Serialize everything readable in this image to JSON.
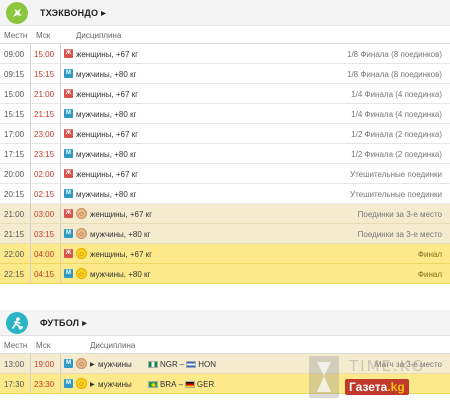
{
  "taekwondo": {
    "title": "ТХЭКВОНДО",
    "columns": {
      "local": "Местн",
      "msk": "Мск",
      "discipline": "Дисциплина"
    },
    "rows": [
      {
        "local": "09:00",
        "msk": "15:00",
        "gender": "Ж",
        "discipline": "женщины, +67 кг",
        "stage": "1/8 Финала (8 поединков)",
        "kind": "plain",
        "medal": ""
      },
      {
        "local": "09:15",
        "msk": "15:15",
        "gender": "М",
        "discipline": "мужчины, +80 кг",
        "stage": "1/8 Финала (8 поединков)",
        "kind": "plain",
        "medal": ""
      },
      {
        "local": "15:00",
        "msk": "21:00",
        "gender": "Ж",
        "discipline": "женщины, +67 кг",
        "stage": "1/4 Финала (4 поединка)",
        "kind": "plain",
        "medal": ""
      },
      {
        "local": "15:15",
        "msk": "21:15",
        "gender": "М",
        "discipline": "мужчины, +80 кг",
        "stage": "1/4 Финала (4 поединка)",
        "kind": "plain",
        "medal": ""
      },
      {
        "local": "17:00",
        "msk": "23:00",
        "gender": "Ж",
        "discipline": "женщины, +67 кг",
        "stage": "1/2 Финала (2 поединка)",
        "kind": "plain",
        "medal": ""
      },
      {
        "local": "17:15",
        "msk": "23:15",
        "gender": "М",
        "discipline": "мужчины, +80 кг",
        "stage": "1/2 Финала (2 поединка)",
        "kind": "plain",
        "medal": ""
      },
      {
        "local": "20:00",
        "msk": "02:00",
        "gender": "Ж",
        "discipline": "женщины, +67 кг",
        "stage": "Утешительные поединки",
        "kind": "plain",
        "medal": ""
      },
      {
        "local": "20:15",
        "msk": "02:15",
        "gender": "М",
        "discipline": "мужчины, +80 кг",
        "stage": "Утешительные поединки",
        "kind": "plain",
        "medal": ""
      },
      {
        "local": "21:00",
        "msk": "03:00",
        "gender": "Ж",
        "discipline": "женщины, +67 кг",
        "stage": "Поединки за 3-е место",
        "kind": "bronze",
        "medal": "☺"
      },
      {
        "local": "21:15",
        "msk": "03:15",
        "gender": "М",
        "discipline": "мужчины, +80 кг",
        "stage": "Поединки за 3-е место",
        "kind": "bronze",
        "medal": "☺"
      },
      {
        "local": "22:00",
        "msk": "04:00",
        "gender": "Ж",
        "discipline": "женщины, +67 кг",
        "stage": "Финал",
        "kind": "gold",
        "medal": "☺"
      },
      {
        "local": "22:15",
        "msk": "04:15",
        "gender": "М",
        "discipline": "мужчины, +80 кг",
        "stage": "Финал",
        "kind": "gold",
        "medal": "☺"
      }
    ]
  },
  "football": {
    "title": "ФУТБОЛ",
    "columns": {
      "local": "Местн",
      "msk": "Мск",
      "discipline": "Дисциплина"
    },
    "rows": [
      {
        "local": "13:00",
        "msk": "19:00",
        "gender": "М",
        "discipline": "мужчины",
        "team1": "NGR",
        "team2": "HON",
        "dash": "–",
        "stage": "Матч за 3-е место",
        "kind": "bronze",
        "medal": "☺"
      },
      {
        "local": "17:30",
        "msk": "23:30",
        "gender": "М",
        "discipline": "мужчины",
        "team1": "BRA",
        "team2": "GER",
        "dash": "–",
        "stage": "",
        "kind": "gold",
        "medal": "☺"
      }
    ]
  },
  "watermark": {
    "top": "TIME.KG",
    "brand": "Газета",
    "suffix": ".kg"
  },
  "colors": {
    "taekwondo_icon": "#8cc63f",
    "football_icon": "#2bb5c4",
    "women": "#d9534f",
    "men": "#2e9bc6",
    "moscow_time": "#c0392b",
    "bronze_row": "#f5eccf",
    "gold_row": "#fbe98a"
  }
}
